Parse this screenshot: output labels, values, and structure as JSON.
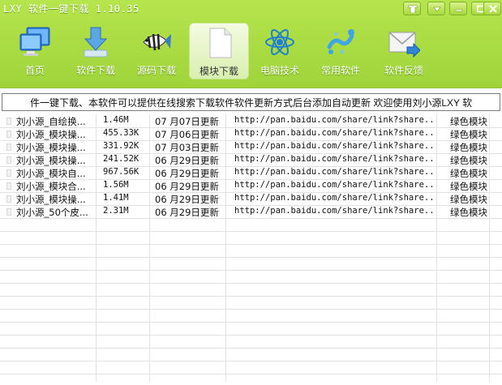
{
  "window": {
    "title": "LXY 软件一键下载 1.10.35",
    "controls": [
      "skin-icon",
      "menu-icon",
      "minimize-icon",
      "maximize-icon",
      "close-icon"
    ]
  },
  "toolbar": {
    "items": [
      {
        "label": "首页",
        "icon": "monitor-icon"
      },
      {
        "label": "软件下载",
        "icon": "download-arrow-icon"
      },
      {
        "label": "源码下载",
        "icon": "fish-icon"
      },
      {
        "label": "模块下载",
        "icon": "document-icon",
        "active": true
      },
      {
        "label": "电脑技术",
        "icon": "atom-icon"
      },
      {
        "label": "常用软件",
        "icon": "splash-icon"
      },
      {
        "label": "软件反馈",
        "icon": "mail-icon"
      }
    ]
  },
  "marquee": {
    "text": "件一键下载、本软件可以提供在线搜索下载软件软件更新方式后台添加自动更新 欢迎使用刘小源LXY 软"
  },
  "table": {
    "rows": [
      {
        "name": "刘小源_自绘换...",
        "size": "1.46M",
        "date": "07 月07日更新",
        "url": "http://pan.baidu.com/share/link?share...",
        "type": "绿色模块"
      },
      {
        "name": "刘小源_模块操...",
        "size": "455.33K",
        "date": "07 月06日更新",
        "url": "http://pan.baidu.com/share/link?share...",
        "type": "绿色模块"
      },
      {
        "name": "刘小源_模块操...",
        "size": "331.92K",
        "date": "07 月03日更新",
        "url": "http://pan.baidu.com/share/link?share...",
        "type": "绿色模块"
      },
      {
        "name": "刘小源_模块操...",
        "size": "241.52K",
        "date": "06 月29日更新",
        "url": "http://pan.baidu.com/share/link?share...",
        "type": "绿色模块"
      },
      {
        "name": "刘小源_模块自...",
        "size": "967.56K",
        "date": "06 月29日更新",
        "url": "http://pan.baidu.com/share/link?share...",
        "type": "绿色模块"
      },
      {
        "name": "刘小源_模块合...",
        "size": "1.56M",
        "date": "06 月29日更新",
        "url": "http://pan.baidu.com/share/link?share...",
        "type": "绿色模块"
      },
      {
        "name": "刘小源_模块操...",
        "size": "1.41M",
        "date": "06 月29日更新",
        "url": "http://pan.baidu.com/share/link?share...",
        "type": "绿色模块"
      },
      {
        "name": "刘小源_50个皮...",
        "size": "2.31M",
        "date": "06 月29日更新",
        "url": "http://pan.baidu.com/share/link?share...",
        "type": "绿色模块"
      }
    ],
    "empty_rows": 12
  },
  "colors": {
    "accent": "#9fd43a",
    "grid_line": "#e2e2e2"
  }
}
